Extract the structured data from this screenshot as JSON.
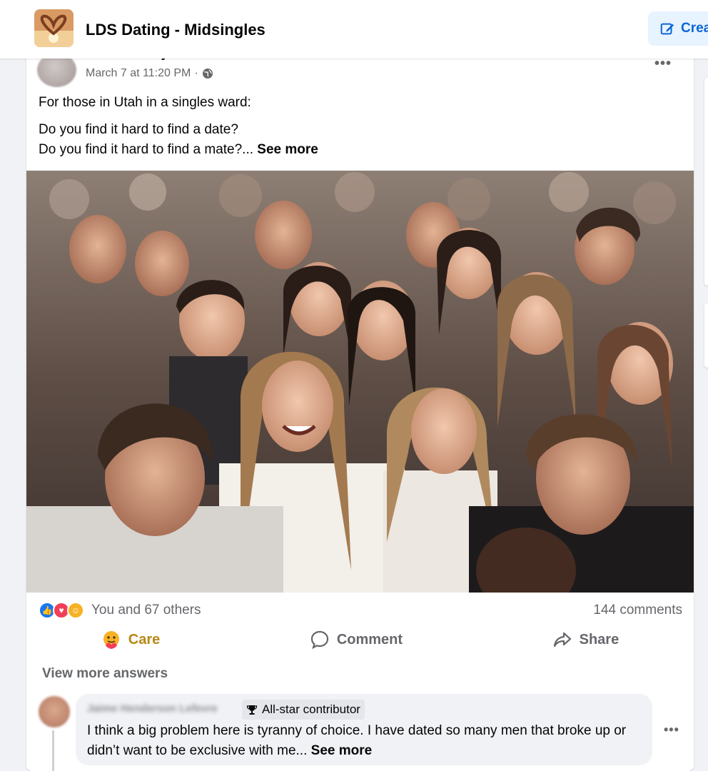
{
  "header": {
    "group_name": "LDS Dating - Midsingles",
    "create_label": "Crea"
  },
  "post": {
    "author": "Aaron Kelley",
    "timestamp": "March 7 at 11:20 PM",
    "separator": "·",
    "more_label": "•••",
    "text_line1": "For those in Utah in a singles ward:",
    "text_line2": "Do you find it hard to find a date?",
    "text_line3": "Do you find it hard to find a mate?...",
    "see_more": "See more"
  },
  "reactions": {
    "icons": [
      "like-icon",
      "love-icon",
      "care-icon"
    ],
    "summary": "You and 67 others",
    "comments_count": "144 comments"
  },
  "actions": {
    "care": "Care",
    "comment": "Comment",
    "share": "Share"
  },
  "comments": {
    "view_more": "View more answers",
    "first": {
      "author": "Jaime Henderson Lefevre",
      "badge": "All-star contributor",
      "text": "I think a big problem here is tyranny of choice. I have dated so many men that broke up or didn’t want to be exclusive with me...",
      "see_more": "See more",
      "more_label": "•••"
    }
  },
  "colors": {
    "accent": "#1877f2",
    "care": "#b88714",
    "muted": "#65676b",
    "bg": "#f0f2f5"
  }
}
